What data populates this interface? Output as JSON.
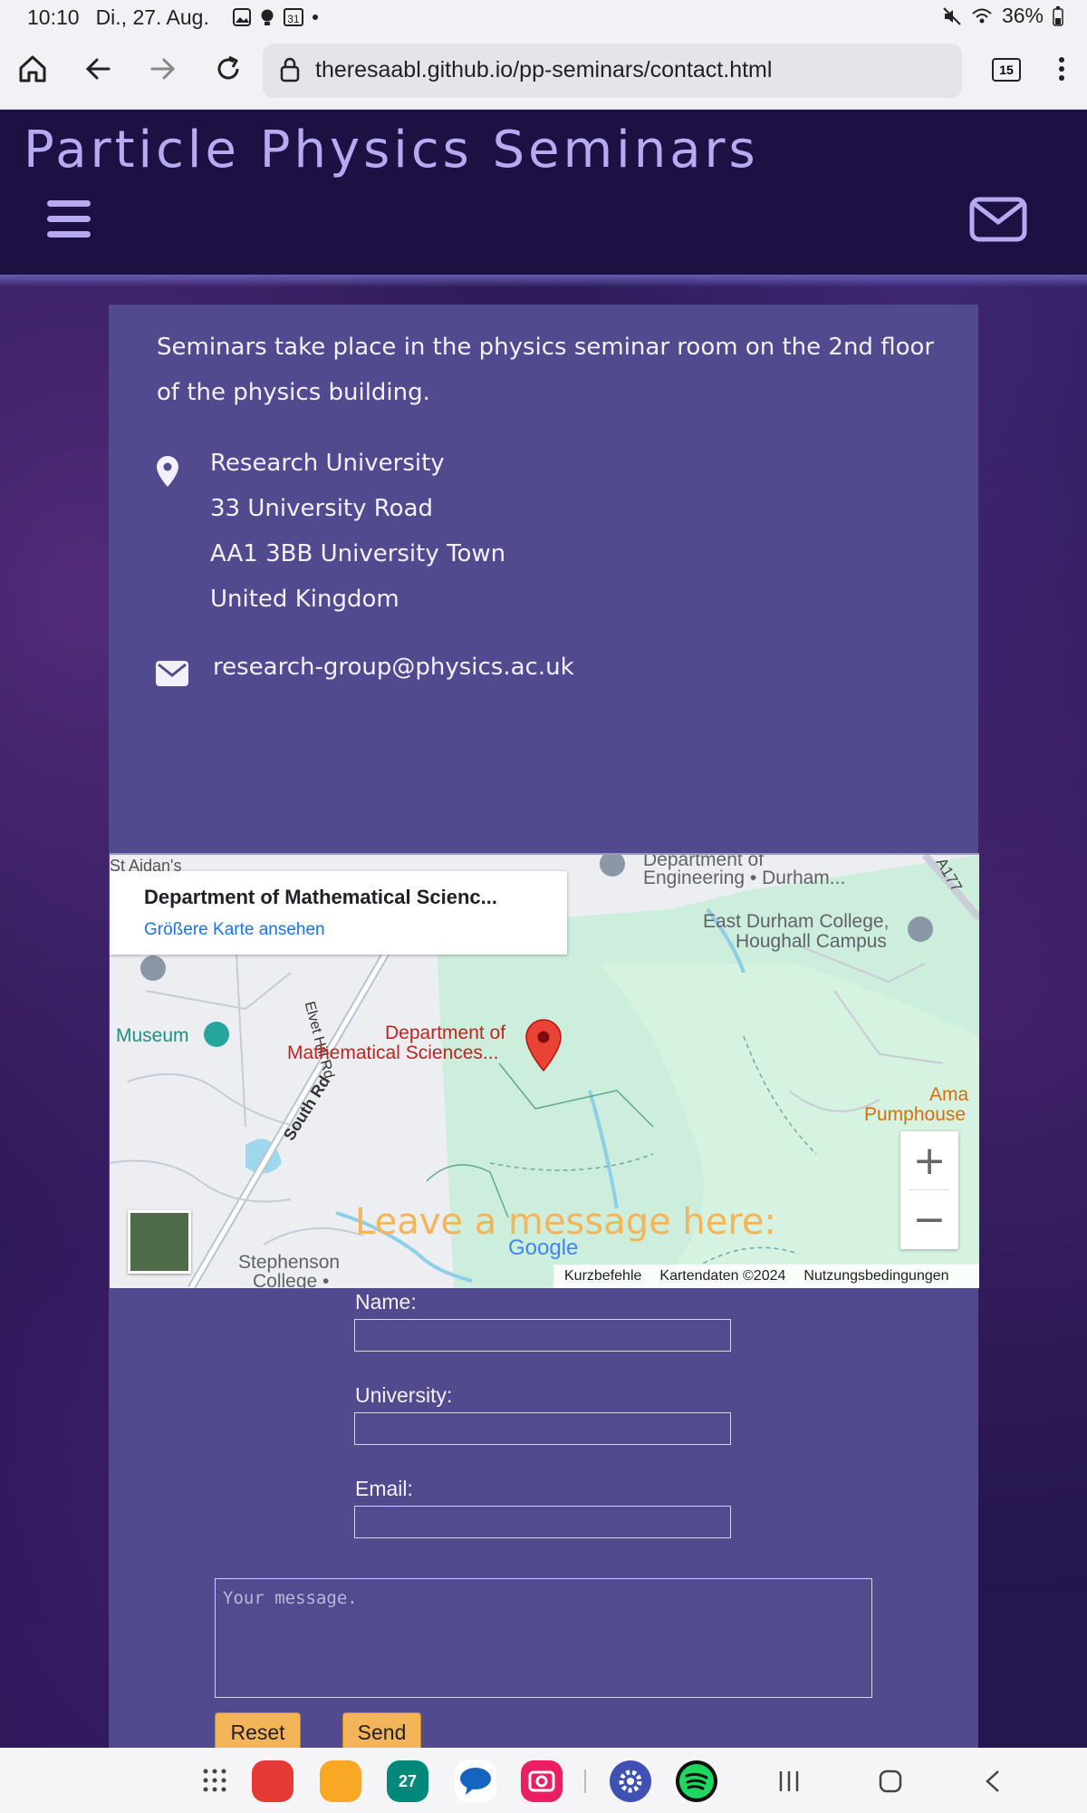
{
  "status_bar": {
    "time": "10:10",
    "date": "Di., 27. Aug.",
    "calendar_badge": "31",
    "battery": "36%"
  },
  "browser": {
    "url": "theresaabl.github.io/pp-seminars/contact.html",
    "tab_count": "15"
  },
  "site": {
    "title": "Particle Physics Seminars"
  },
  "contact": {
    "intro": "Seminars take place in the physics seminar room on the 2nd floor of the physics building.",
    "address": [
      "Research University",
      "33 University Road",
      "AA1 3BB University Town",
      "United Kingdom"
    ],
    "email": "research-group@physics.ac.uk"
  },
  "map": {
    "place_title": "Department of Mathematical Scienc...",
    "larger_map_link": "Größere Karte ansehen",
    "labels": {
      "dept_engineering_1": "Department of",
      "dept_engineering_2": "Engineering • Durham...",
      "east_durham_1": "East Durham College,",
      "east_durham_2": "Houghall Campus",
      "museum": "Museum",
      "elvet": "Elvet Hill Rd",
      "south_rd": "South Rd",
      "dept_math_1": "Department of",
      "dept_math_2": "Mathematical Sciences...",
      "ama_1": "Ama",
      "ama_2": "Pumphouse",
      "a177": "A177",
      "stephenson_1": "Stephenson",
      "stephenson_2": "College •",
      "st_aidans": "St Aidan's"
    },
    "google": "Google",
    "footer": [
      "Kurzbefehle",
      "Kartendaten ©2024",
      "Nutzungsbedingungen"
    ],
    "zoom_in": "+",
    "zoom_out": "−"
  },
  "form": {
    "title": "Leave a message here:",
    "name_label": "Name:",
    "university_label": "University:",
    "email_label": "Email:",
    "message_placeholder": "Your message.",
    "reset": "Reset",
    "send": "Send"
  },
  "nav_apps": {
    "calendar_day": "27"
  }
}
